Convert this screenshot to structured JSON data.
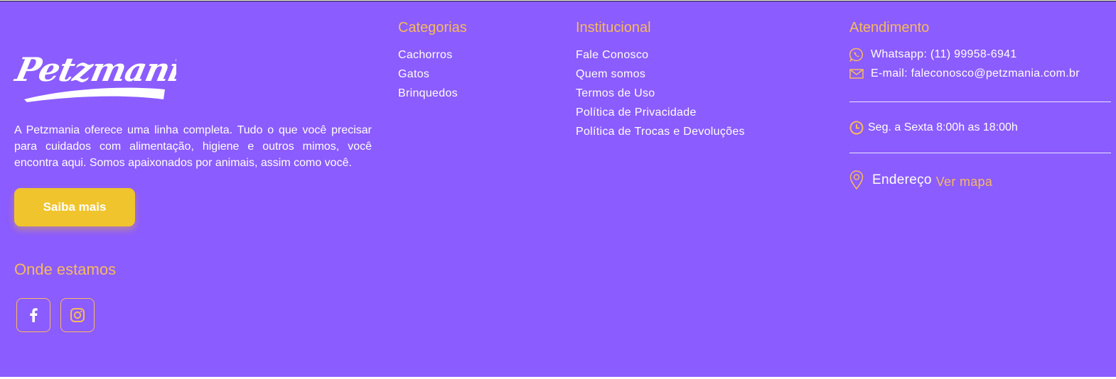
{
  "brand": {
    "logo_text": "Petzmania",
    "description": "A Petzmania oferece uma linha completa. Tudo o que você precisar para cuidados com alimentação, higiene e outros mimos, você encontra aqui. Somos apaixonados por animais, assim como você.",
    "cta_label": "Saiba mais"
  },
  "location": {
    "title": "Onde estamos",
    "social": [
      {
        "icon": "facebook-icon"
      },
      {
        "icon": "instagram-icon"
      }
    ]
  },
  "categories": {
    "title": "Categorias",
    "items": [
      "Cachorros",
      "Gatos",
      "Brinquedos"
    ]
  },
  "institutional": {
    "title": "Institucional",
    "items": [
      "Fale Conosco",
      "Quem somos",
      "Termos de Uso",
      "Política de Privacidade",
      "Política de Trocas e Devoluções"
    ]
  },
  "support": {
    "title": "Atendimento",
    "whatsapp": "Whatsapp: (11) 99958-6941",
    "email": "E-mail: faleconosco@petzmania.com.br",
    "hours": "Seg. a Sexta 8:00h as 18:00h",
    "address_label": "Endereço",
    "map_link": "Ver mapa"
  },
  "colors": {
    "background": "#8b5cff",
    "accent": "#f7b95e",
    "button": "#f0c42c",
    "text": "#ffffff"
  }
}
